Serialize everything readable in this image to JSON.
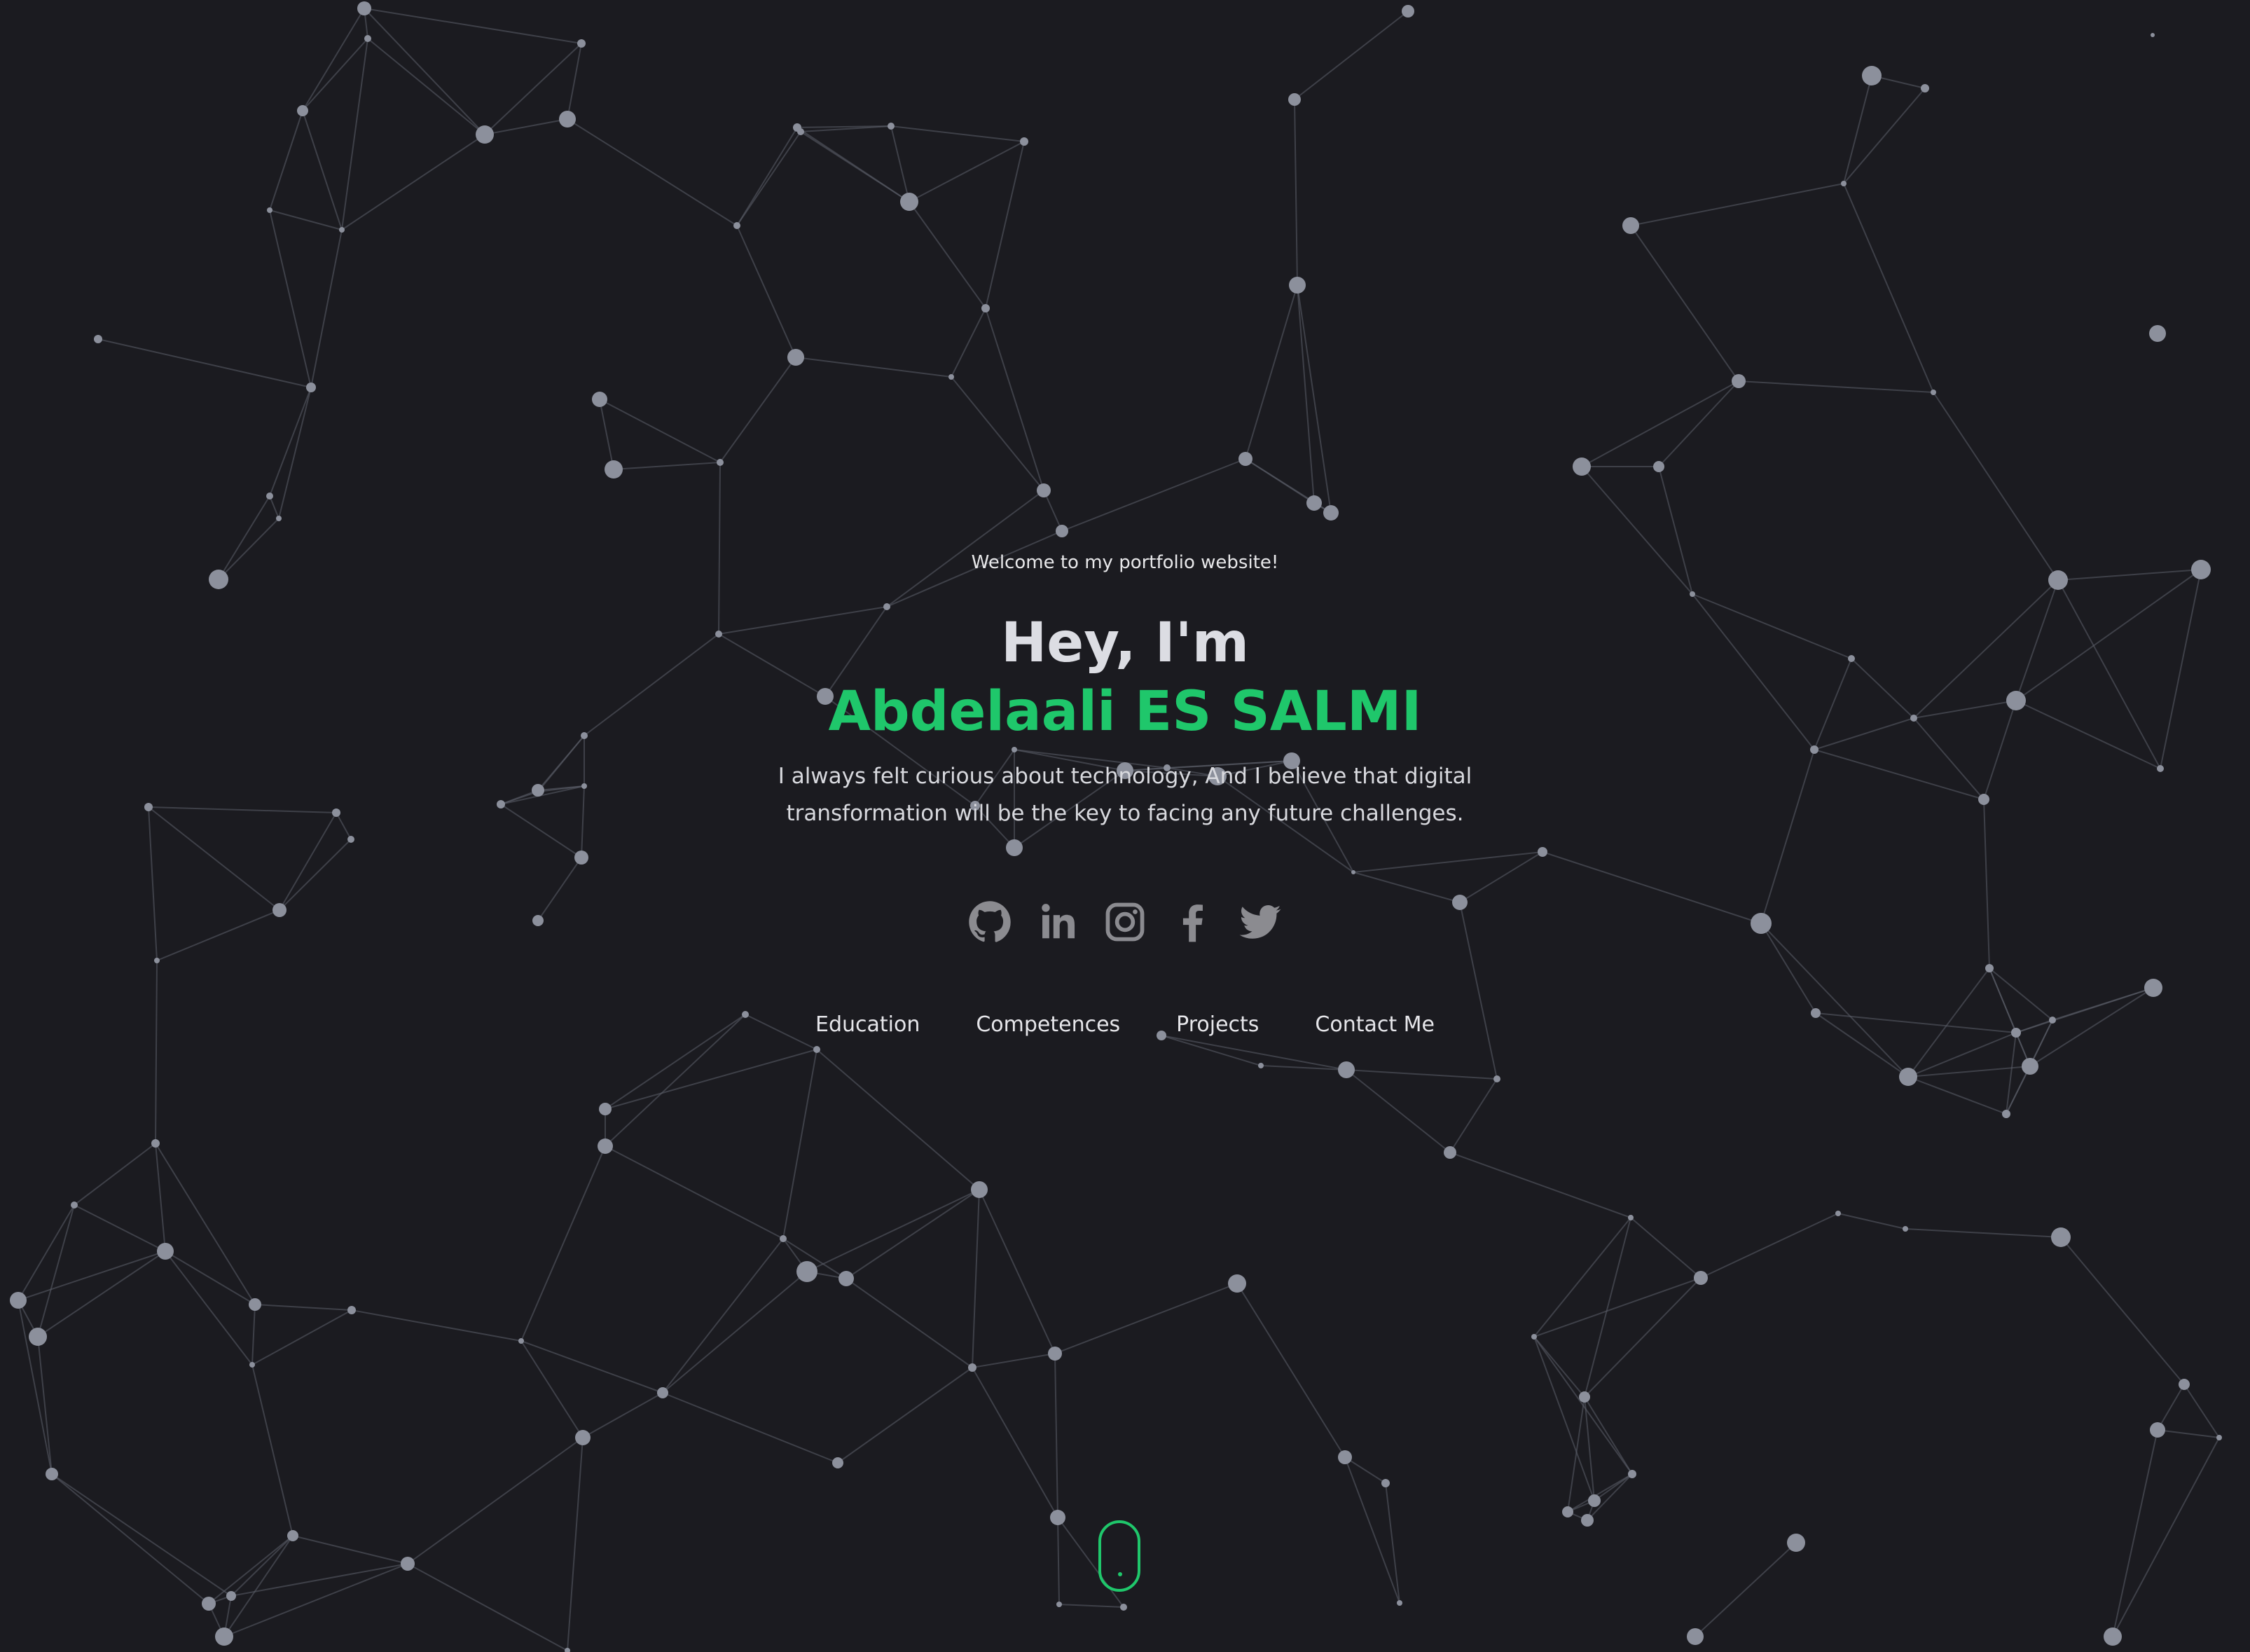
{
  "hero": {
    "welcome": "Welcome to my portfolio website!",
    "greeting": "Hey, I'm",
    "name": "Abdelaali ES SALMI",
    "bio": "I always felt curious about technology, And I believe that digital transformation will be the key to facing any future challenges."
  },
  "socials": [
    {
      "label": "GitHub",
      "icon": "github-icon"
    },
    {
      "label": "LinkedIn",
      "icon": "linkedin-icon"
    },
    {
      "label": "Instagram",
      "icon": "instagram-icon"
    },
    {
      "label": "Facebook",
      "icon": "facebook-icon"
    },
    {
      "label": "Twitter",
      "icon": "twitter-icon"
    }
  ],
  "nav": {
    "education": "Education",
    "competences": "Competences",
    "projects": "Projects",
    "contact": "Contact Me"
  },
  "scroll_indicator": {
    "icon": "mouse-scroll-icon"
  },
  "colors": {
    "background": "#1b1b20",
    "accent": "#1fc76b",
    "icon": "#8b8b90",
    "particle": "#8c909c",
    "particle_line": "#5c5f6a"
  }
}
